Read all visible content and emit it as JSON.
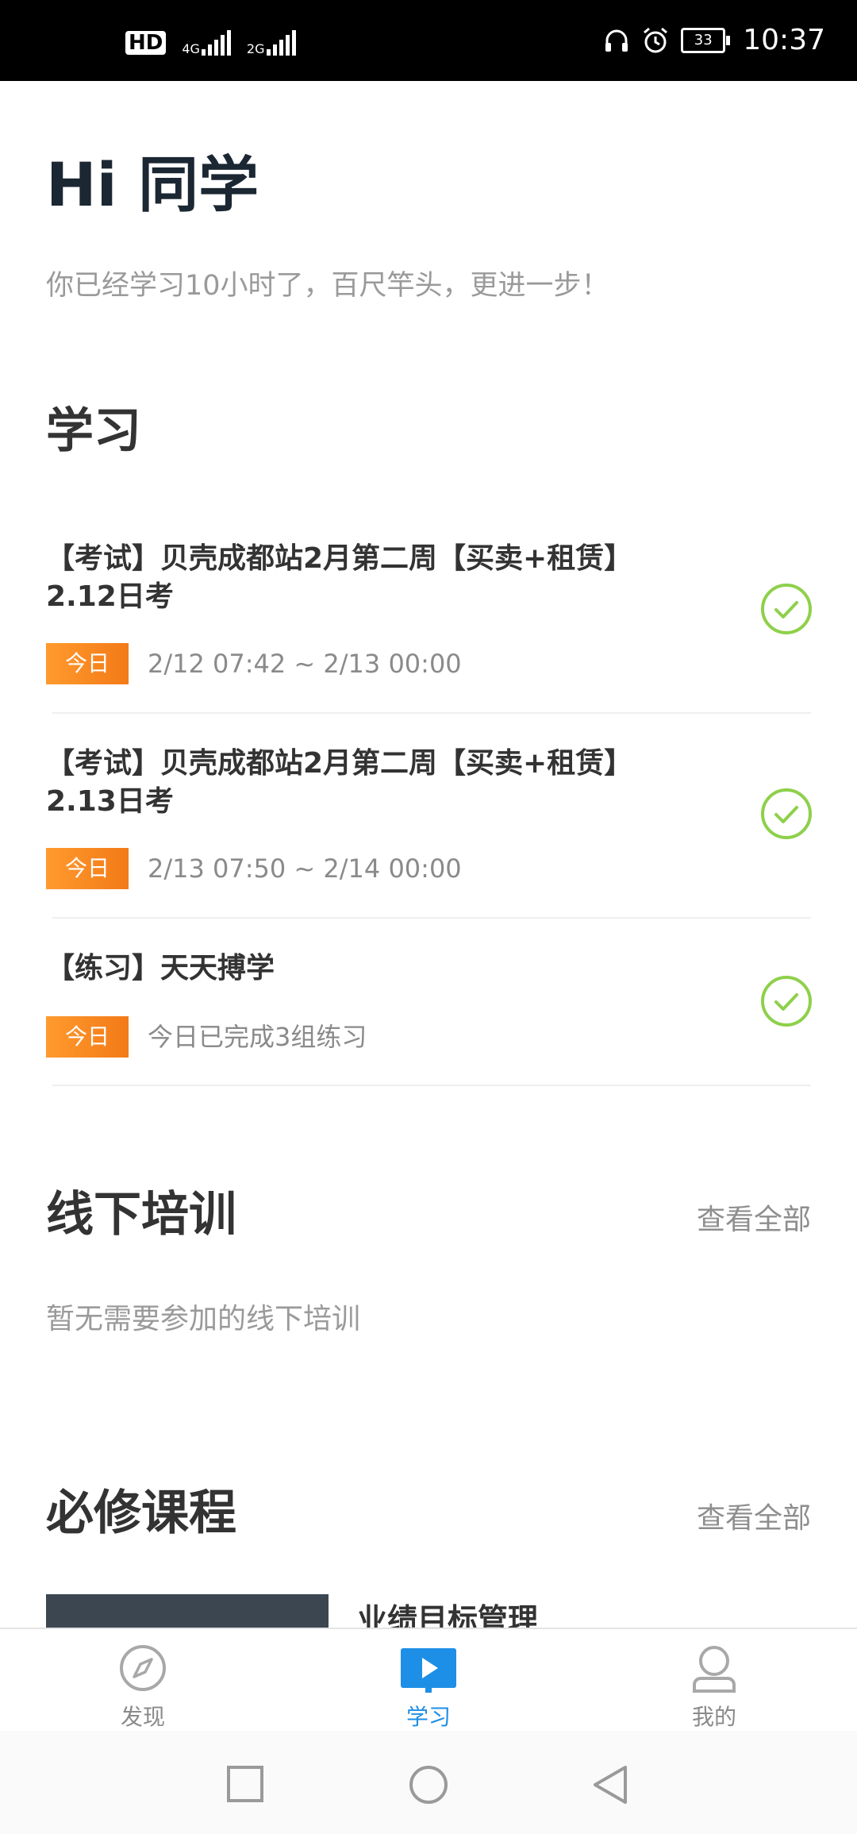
{
  "status_bar": {
    "hd": "HD",
    "sim1_net": "4G",
    "sim2_net": "2G",
    "battery": "33",
    "time": "10:37"
  },
  "greeting": {
    "title": "Hi 同学",
    "subtitle": "你已经学习10小时了，百尺竿头，更进一步！"
  },
  "study": {
    "section_title": "学习",
    "items": [
      {
        "title": "【考试】贝壳成都站2月第二周【买卖+租赁】2.12日考",
        "tag": "今日",
        "time": "2/12 07:42 ~ 2/13 00:00",
        "status": "completed"
      },
      {
        "title": "【考试】贝壳成都站2月第二周【买卖+租赁】2.13日考",
        "tag": "今日",
        "time": "2/13 07:50 ~ 2/14 00:00",
        "status": "completed"
      },
      {
        "title": "【练习】天天搏学",
        "tag": "今日",
        "time": "今日已完成3组练习",
        "status": "completed"
      }
    ]
  },
  "offline_training": {
    "section_title": "线下培训",
    "see_all": "查看全部",
    "empty_text": "暂无需要参加的线下培训"
  },
  "required_courses": {
    "section_title": "必修课程",
    "see_all": "查看全部",
    "first_course_title": "业绩目标管理"
  },
  "tab_bar": {
    "tabs": [
      {
        "label": "发现",
        "icon": "compass-icon",
        "active": false
      },
      {
        "label": "学习",
        "icon": "play-icon",
        "active": true
      },
      {
        "label": "我的",
        "icon": "user-icon",
        "active": false
      }
    ]
  },
  "colors": {
    "accent": "#1e8fe6",
    "tag_orange": "#f5841f",
    "check_green": "#8ed04a",
    "title_dark": "#1b2733"
  }
}
